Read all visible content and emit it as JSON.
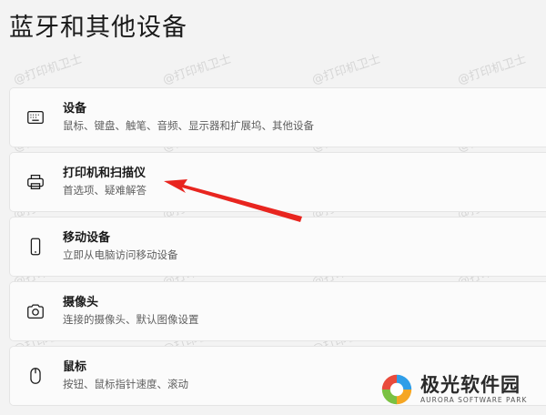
{
  "page": {
    "title": "蓝牙和其他设备"
  },
  "items": [
    {
      "title": "设备",
      "desc": "鼠标、键盘、触笔、音频、显示器和扩展坞、其他设备",
      "icon": "keyboard-device-icon"
    },
    {
      "title": "打印机和扫描仪",
      "desc": "首选项、疑难解答",
      "icon": "printer-icon"
    },
    {
      "title": "移动设备",
      "desc": "立即从电脑访问移动设备",
      "icon": "phone-icon"
    },
    {
      "title": "摄像头",
      "desc": "连接的摄像头、默认图像设置",
      "icon": "camera-icon"
    },
    {
      "title": "鼠标",
      "desc": "按钮、鼠标指针速度、滚动",
      "icon": "mouse-icon"
    }
  ],
  "watermark": {
    "text": "@打印机卫士"
  },
  "annotation": {
    "arrow_color": "#e8251f"
  },
  "logo": {
    "name": "极光软件园",
    "sub": "AURORA SOFTWARE PARK"
  }
}
